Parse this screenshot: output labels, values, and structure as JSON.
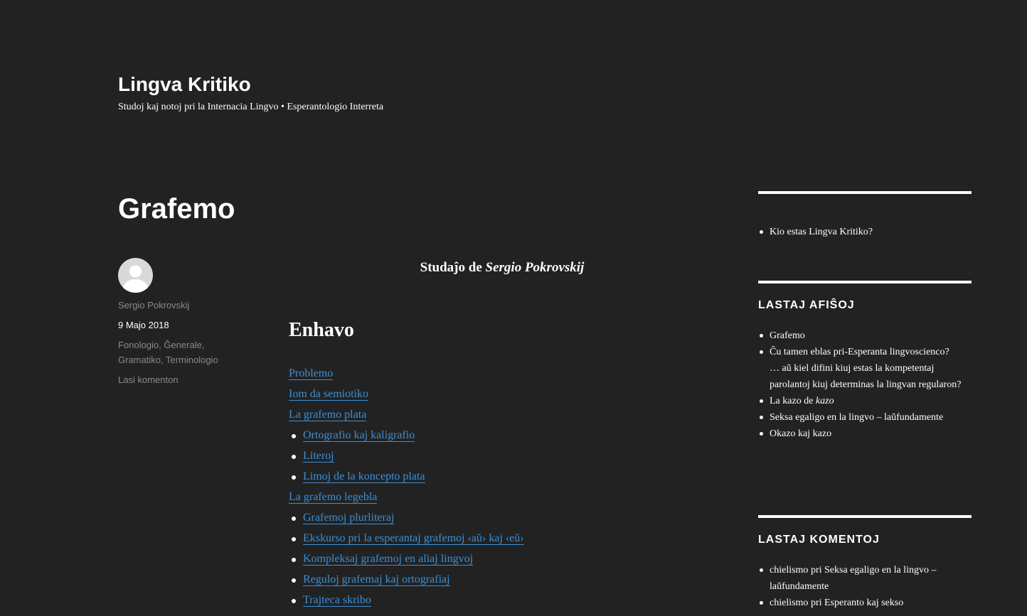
{
  "site": {
    "title": "Lingva Kritiko",
    "description": "Studoj kaj notoj pri la Internacia Lingvo • Esperantologio Interreta"
  },
  "entry": {
    "title": "Grafemo",
    "author": "Sergio Pokrovskij",
    "date": "9 Majo 2018",
    "categories": [
      "Fonologio",
      "Ĝenerale",
      "Gramatiko",
      "Terminologio"
    ],
    "comment_link": "Lasi komenton",
    "study_prefix": "Studaĵo de ",
    "study_author": "Sergio Pokrovskij",
    "toc_title": "Enhavo",
    "toc": [
      {
        "label": "Problemo",
        "level": 1
      },
      {
        "label": "Iom da semiotiko",
        "level": 1
      },
      {
        "label": "La grafemo plata",
        "level": 1
      },
      {
        "label": "Ortografio kaj kaligrafio",
        "level": 2
      },
      {
        "label": "Literoj",
        "level": 2
      },
      {
        "label": "Limoj de la koncepto plata",
        "level": 2
      },
      {
        "label": "La grafemo legebla",
        "level": 1
      },
      {
        "label": "Grafemoj plurliteraj",
        "level": 2
      },
      {
        "label": "Ekskurso pri la esperantaj grafemoj ‹aŭ› kaj ‹eŭ›",
        "level": 2
      },
      {
        "label": "Kompleksaj grafemoj en aliaj lingvoj",
        "level": 2
      },
      {
        "label": "Reguloj grafemaj kaj ortografiaj",
        "level": 2
      },
      {
        "label": "Trajteca skribo",
        "level": 2
      }
    ]
  },
  "sidebar": {
    "pages": [
      "Kio estas Lingva Kritiko?"
    ],
    "recent_posts_title": "LASTAJ AFIŜOJ",
    "recent_posts": [
      {
        "text": "Grafemo"
      },
      {
        "text": "Ĉu tamen eblas pri-Esperanta lingvoscienco?"
      },
      {
        "text": "… aŭ kiel difini kiuj estas la kompetentaj parolantoj kiuj determinas la lingvan regularon?",
        "continuation": true
      },
      {
        "text": "La kazo de ",
        "em": "kazo"
      },
      {
        "text": "Seksa egaligo en la lingvo – laŭfundamente"
      },
      {
        "text": "Okazo kaj kazo"
      }
    ],
    "recent_comments_title": "LASTAJ KOMENTOJ",
    "recent_comments": [
      {
        "author": "chielismo",
        "connector": " pri ",
        "post": "Seksa egaligo en la lingvo – laŭfundamente"
      },
      {
        "author": "chielismo",
        "connector": " pri ",
        "post": "Esperanto kaj sekso"
      }
    ]
  }
}
